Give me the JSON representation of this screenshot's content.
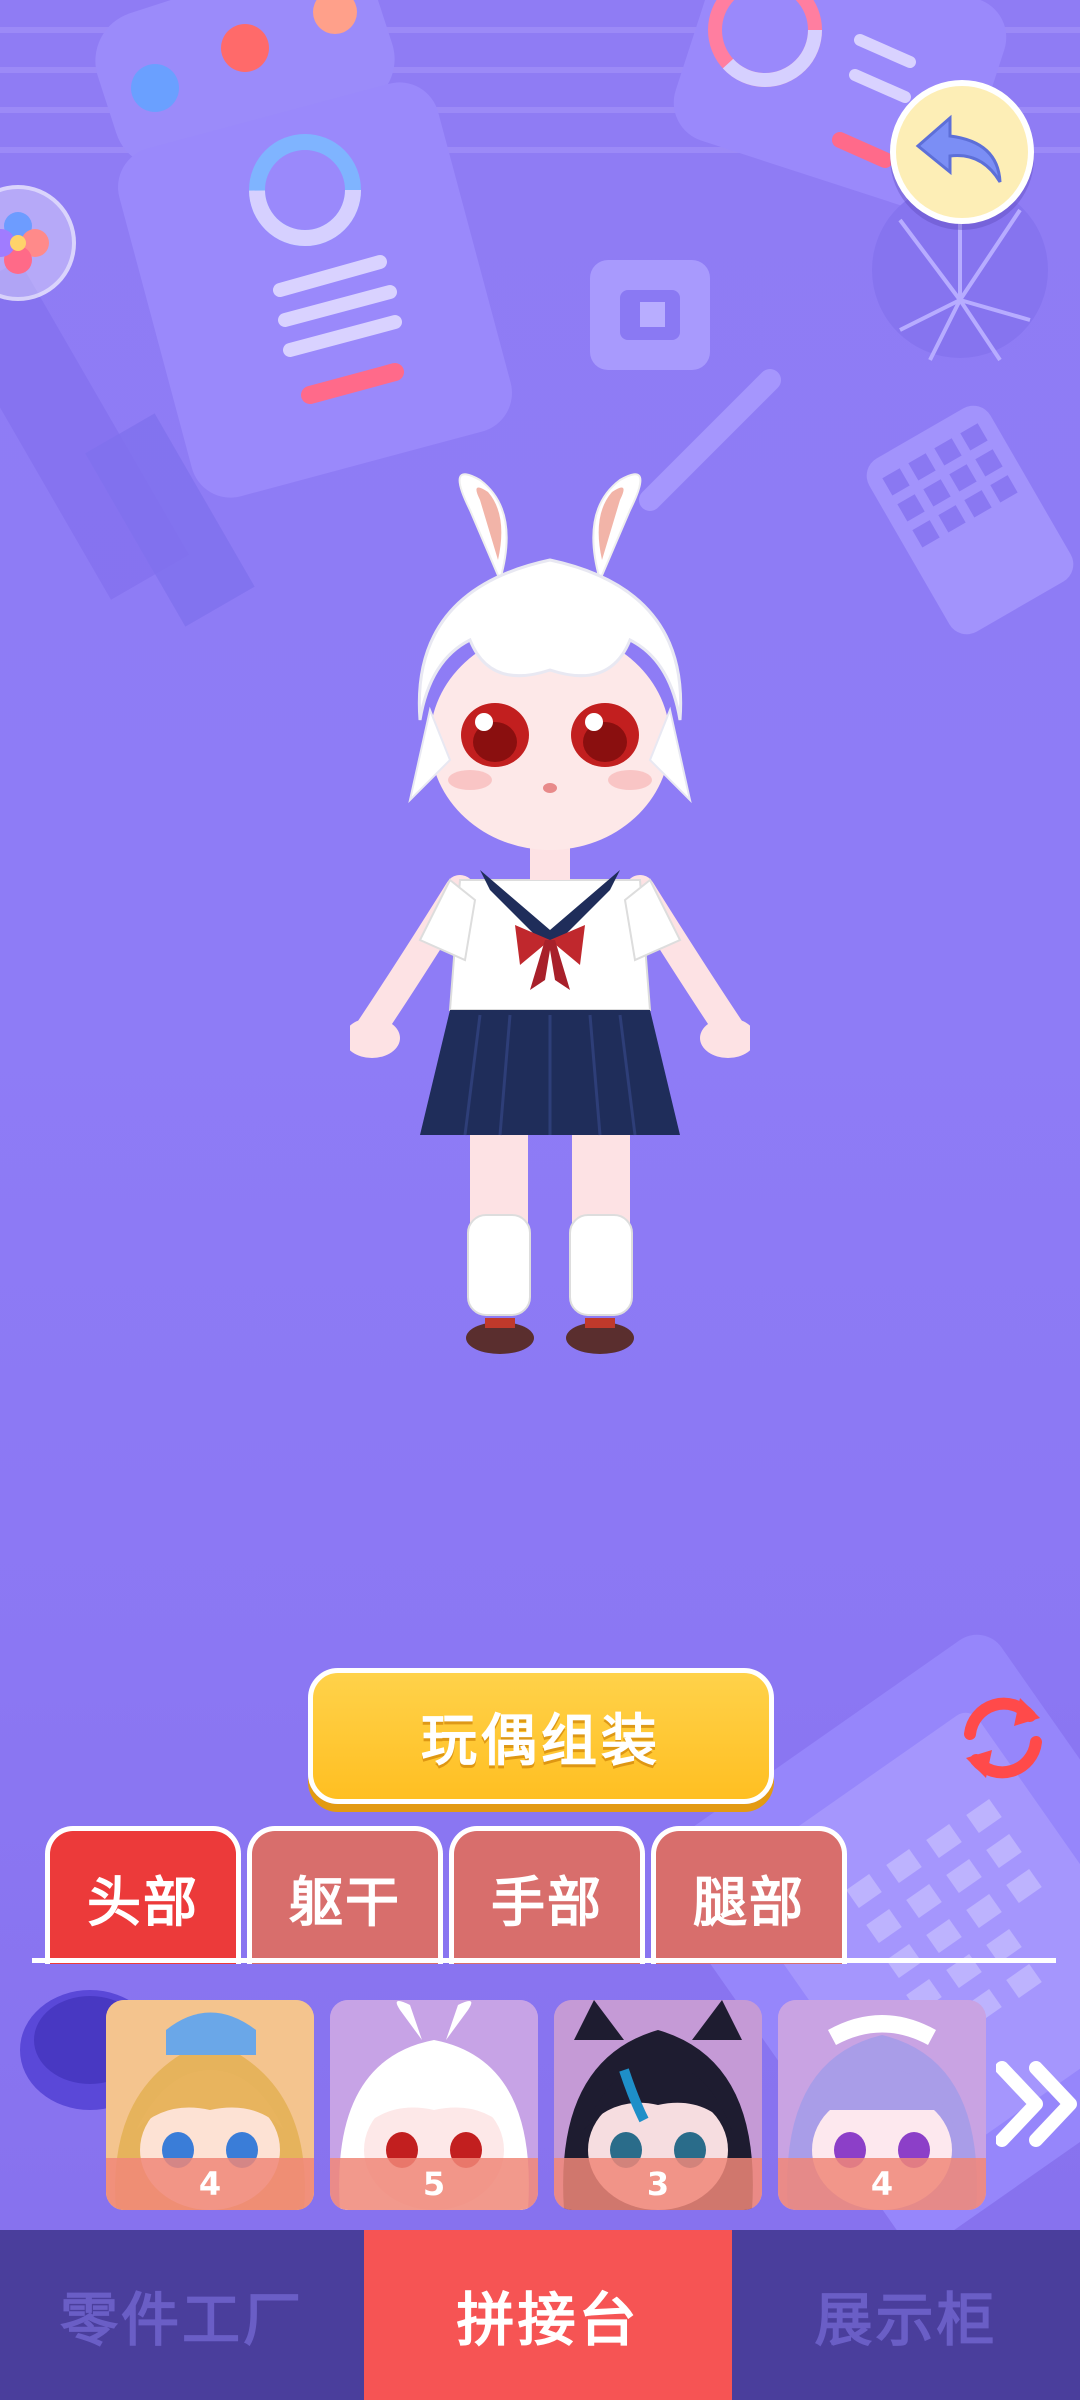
{
  "screen": {
    "assemble_button": "玩偶组装",
    "icons": {
      "back": "back-arrow-icon",
      "side": "flower-icon",
      "refresh": "refresh-icon",
      "more": "double-chevron-right-icon"
    }
  },
  "tabs": [
    {
      "label": "头部",
      "active": true
    },
    {
      "label": "躯干",
      "active": false
    },
    {
      "label": "手部",
      "active": false
    },
    {
      "label": "腿部",
      "active": false
    }
  ],
  "parts": [
    {
      "name": "blonde-hair",
      "count": "4"
    },
    {
      "name": "white-bunny-hair",
      "count": "5"
    },
    {
      "name": "black-cat-hair",
      "count": "3"
    },
    {
      "name": "lavender-maid-hair",
      "count": "4"
    }
  ],
  "bottom_nav": [
    {
      "label": "零件工厂",
      "active": false
    },
    {
      "label": "拼接台",
      "active": true
    },
    {
      "label": "展示柜",
      "active": false
    }
  ],
  "colors": {
    "background": "#8e7cf6",
    "assemble_button": "#ffc22a",
    "tab_active": "#ec3a3a",
    "tab_inactive": "#d86e6c",
    "nav_bg": "#4a3e9c",
    "nav_active": "#f65454"
  }
}
